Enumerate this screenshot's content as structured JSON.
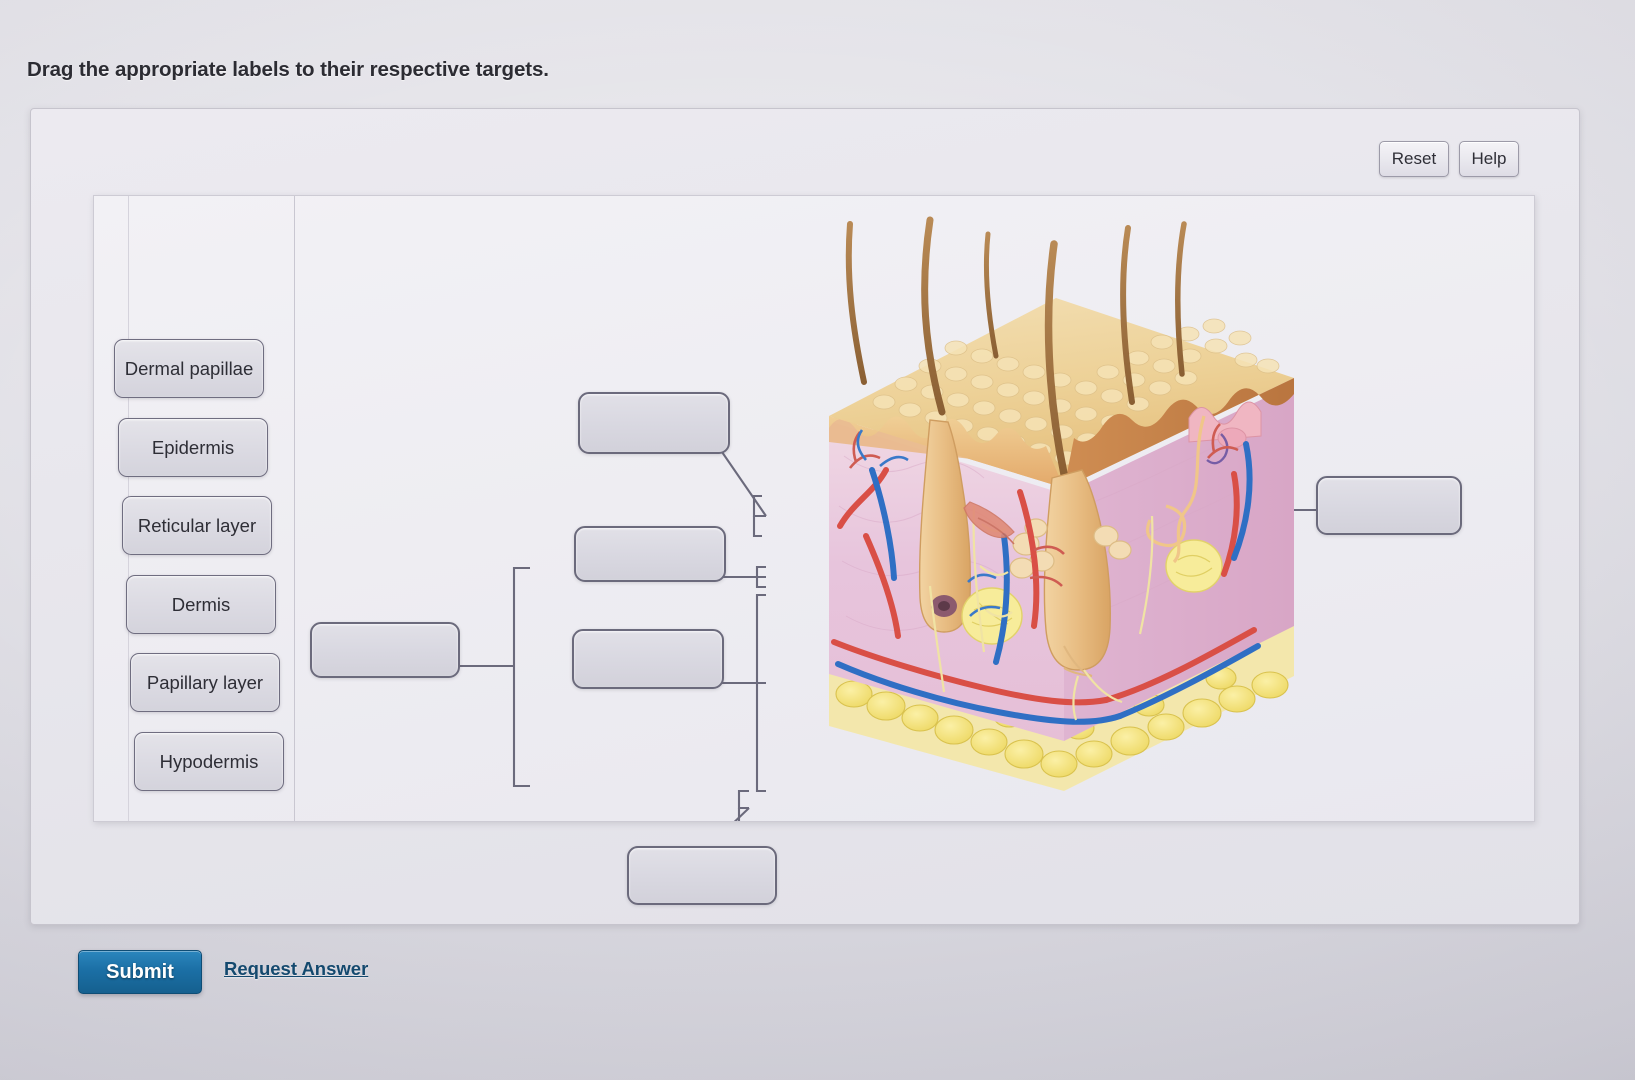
{
  "instruction": "Drag the appropriate labels to their respective targets.",
  "toolbar": {
    "reset_label": "Reset",
    "help_label": "Help"
  },
  "footer": {
    "submit_label": "Submit",
    "request_answer_label": "Request Answer"
  },
  "label_bank": {
    "items": [
      {
        "label": "Dermal papillae"
      },
      {
        "label": "Epidermis"
      },
      {
        "label": "Reticular layer"
      },
      {
        "label": "Dermis"
      },
      {
        "label": "Papillary layer"
      },
      {
        "label": "Hypodermis"
      }
    ]
  },
  "drop_targets": [
    {
      "id": "target-top",
      "value": ""
    },
    {
      "id": "target-upper-middle",
      "value": ""
    },
    {
      "id": "target-lower-middle",
      "value": ""
    },
    {
      "id": "target-left",
      "value": ""
    },
    {
      "id": "target-right",
      "value": ""
    },
    {
      "id": "target-bottom",
      "value": ""
    }
  ],
  "diagram": {
    "name": "skin-cross-section",
    "description": "Cross-section block of human skin with hair shafts, epidermis, dermis and hypodermis"
  },
  "colors": {
    "accent": "#1b6fa5",
    "link": "#14496e",
    "chip_border": "#6f6d80",
    "panel_bg": "#eeedf2"
  }
}
